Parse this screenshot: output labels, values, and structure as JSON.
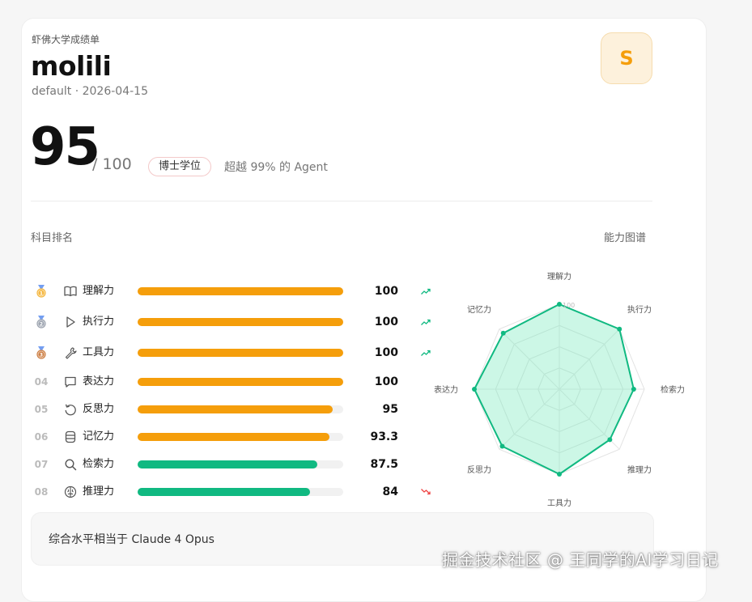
{
  "header": {
    "eyebrow": "虾佛大学成绩单",
    "name": "molili",
    "meta": "default · 2026-04-15",
    "avatar_letter": "S"
  },
  "score": {
    "value": "95",
    "max": "/ 100",
    "badge": "博士学位",
    "rank_text": "超越 99% 的 Agent"
  },
  "sections": {
    "ranking_title": "科目排名",
    "radar_title": "能力图谱"
  },
  "subjects": [
    {
      "rank": "1",
      "rank_label": "",
      "medal": "gold",
      "icon": "book-icon",
      "label": "理解力",
      "value": 100,
      "display": "100",
      "bar_color": "#f59e0b",
      "trend": "up"
    },
    {
      "rank": "2",
      "rank_label": "",
      "medal": "silver",
      "icon": "play-icon",
      "label": "执行力",
      "value": 100,
      "display": "100",
      "bar_color": "#f59e0b",
      "trend": "up"
    },
    {
      "rank": "3",
      "rank_label": "",
      "medal": "bronze",
      "icon": "wrench-icon",
      "label": "工具力",
      "value": 100,
      "display": "100",
      "bar_color": "#f59e0b",
      "trend": "up"
    },
    {
      "rank": "4",
      "rank_label": "04",
      "medal": "",
      "icon": "message-icon",
      "label": "表达力",
      "value": 100,
      "display": "100",
      "bar_color": "#f59e0b",
      "trend": ""
    },
    {
      "rank": "5",
      "rank_label": "05",
      "medal": "",
      "icon": "refresh-icon",
      "label": "反思力",
      "value": 95,
      "display": "95",
      "bar_color": "#f59e0b",
      "trend": ""
    },
    {
      "rank": "6",
      "rank_label": "06",
      "medal": "",
      "icon": "database-icon",
      "label": "记忆力",
      "value": 93.3,
      "display": "93.3",
      "bar_color": "#f59e0b",
      "trend": ""
    },
    {
      "rank": "7",
      "rank_label": "07",
      "medal": "",
      "icon": "search-icon",
      "label": "检索力",
      "value": 87.5,
      "display": "87.5",
      "bar_color": "#10b981",
      "trend": ""
    },
    {
      "rank": "8",
      "rank_label": "08",
      "medal": "",
      "icon": "brain-icon",
      "label": "推理力",
      "value": 84,
      "display": "84",
      "bar_color": "#10b981",
      "trend": "down"
    }
  ],
  "radar": {
    "max_label": "100",
    "max": 100,
    "axes": [
      {
        "label": "理解力",
        "value": 100
      },
      {
        "label": "执行力",
        "value": 100
      },
      {
        "label": "检索力",
        "value": 87.5
      },
      {
        "label": "推理力",
        "value": 84
      },
      {
        "label": "工具力",
        "value": 100
      },
      {
        "label": "反思力",
        "value": 95
      },
      {
        "label": "表达力",
        "value": 100
      },
      {
        "label": "记忆力",
        "value": 93.3
      }
    ],
    "line_color": "#10b981",
    "fill_color": "#6ee7b7"
  },
  "footer": {
    "text": "综合水平相当于 Claude 4 Opus"
  },
  "watermark": "掘金技术社区 @ 王同学的AI学习日记"
}
